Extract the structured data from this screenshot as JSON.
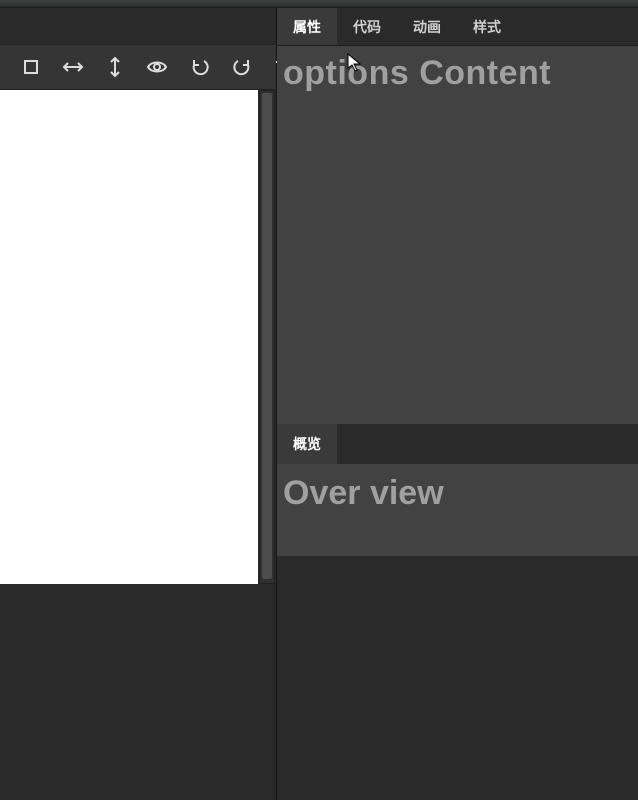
{
  "tabs": [
    {
      "label": "属性",
      "active": true
    },
    {
      "label": "代码",
      "active": false
    },
    {
      "label": "动画",
      "active": false
    },
    {
      "label": "样式",
      "active": false
    }
  ],
  "options_panel": {
    "title": "options Content"
  },
  "overview": {
    "tab_label": "概览",
    "title": "Over view"
  },
  "toolbar": {
    "tools": [
      {
        "name": "select-box"
      },
      {
        "name": "arrows-horizontal"
      },
      {
        "name": "arrows-vertical"
      },
      {
        "name": "visibility"
      },
      {
        "name": "undo"
      },
      {
        "name": "redo"
      },
      {
        "name": "delete"
      }
    ]
  }
}
